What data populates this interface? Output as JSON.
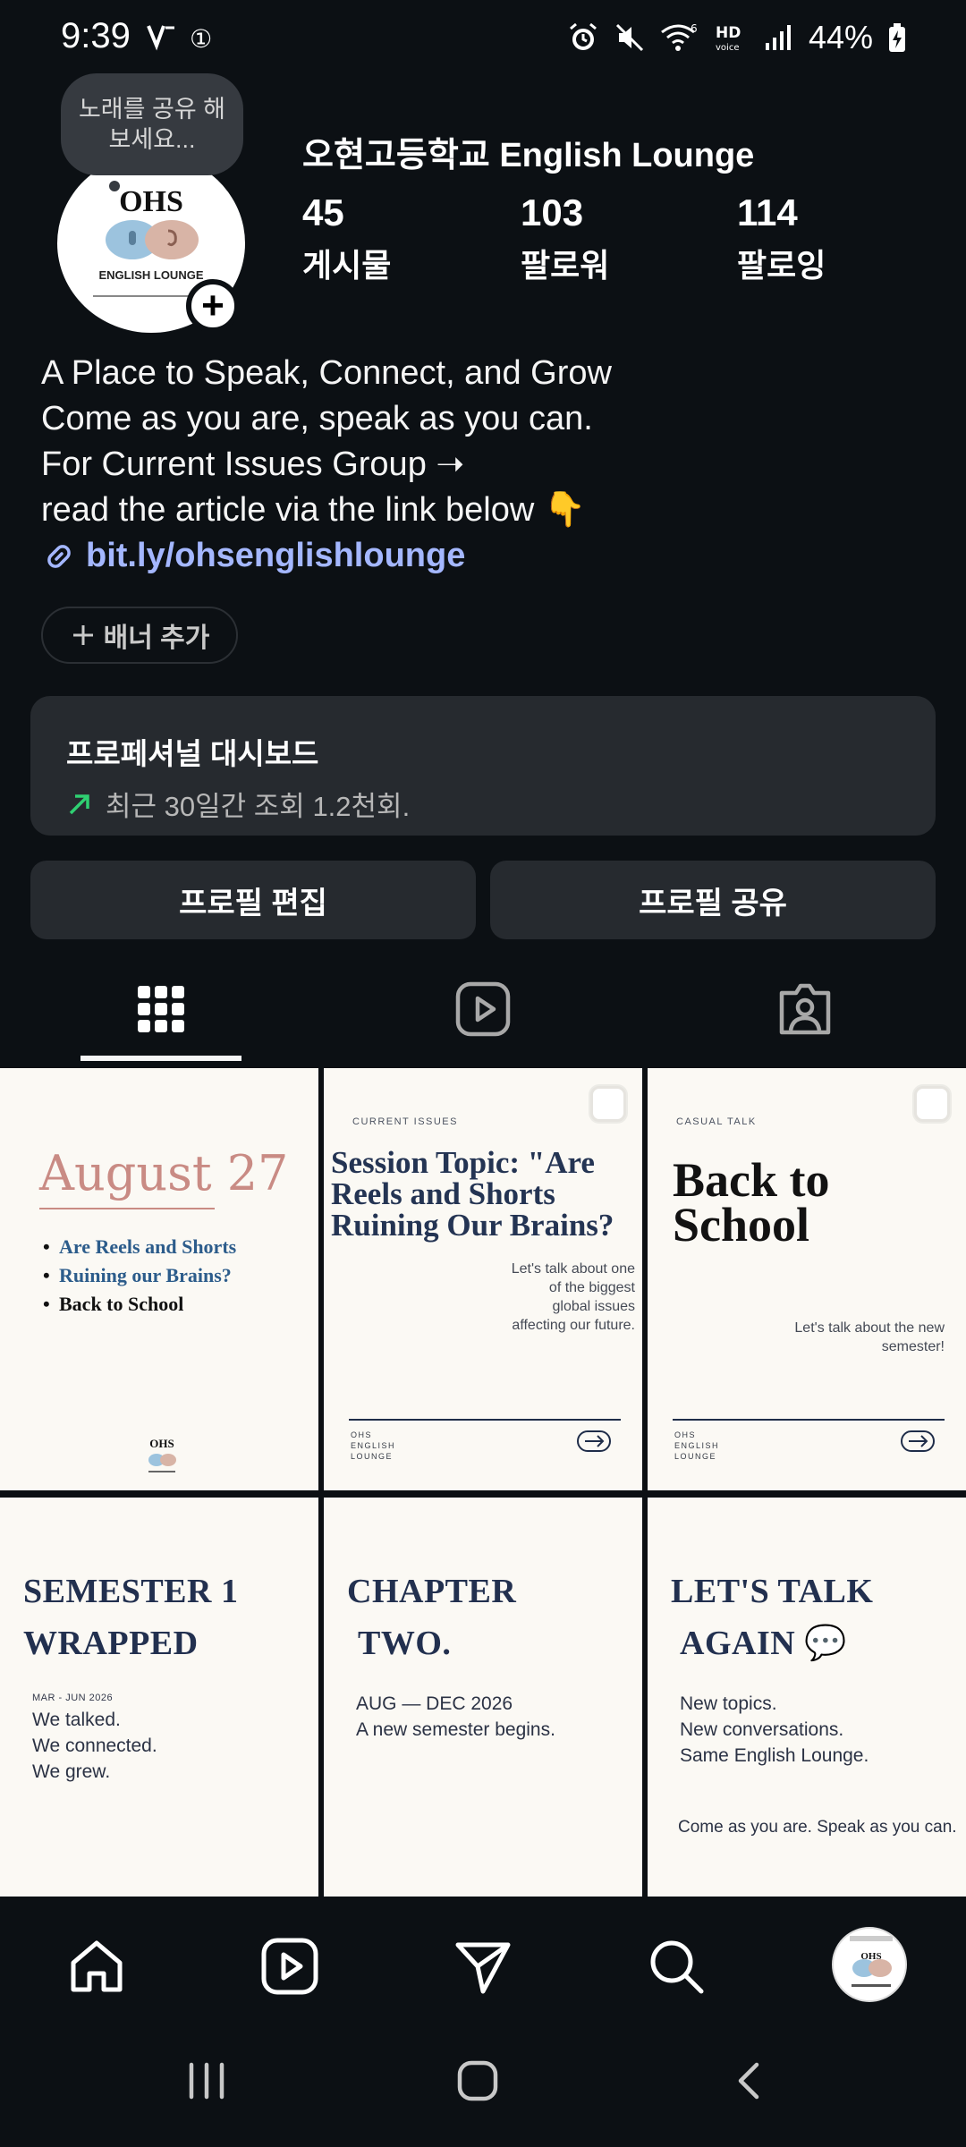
{
  "status": {
    "time": "9:39",
    "time_suffix": "①",
    "battery": "44%"
  },
  "profile": {
    "note": "노래를 공유 해보세요...",
    "name": "오현고등학교 English Lounge",
    "avatar_logo_text": "OHS",
    "avatar_caption": "ENGLISH LOUNGE",
    "stats": [
      {
        "value": "45",
        "label": "게시물"
      },
      {
        "value": "103",
        "label": "팔로워"
      },
      {
        "value": "114",
        "label": "팔로잉"
      }
    ],
    "bio": [
      "A Place to Speak, Connect, and Grow",
      "Come as you are, speak as you can.",
      "For Current Issues Group ➝",
      "read the article via the link below 👇"
    ],
    "link": "bit.ly/ohsenglishlounge",
    "banner_button": "배너 추가"
  },
  "dashboard": {
    "title": "프로페셔널 대시보드",
    "subtitle": "최근 30일간 조회 1.2천회."
  },
  "actions": {
    "edit": "프로필 편집",
    "share": "프로필 공유"
  },
  "posts": {
    "p1": {
      "title": "August 27",
      "items": [
        "Are Reels and Shorts",
        "Ruining our Brains?",
        "Back to School"
      ],
      "logo": "OHS"
    },
    "p2": {
      "eyebrow": "CURRENT ISSUES",
      "title": "Session Topic: \"Are Reels and Shorts Ruining Our Brains?",
      "desc": "Let's talk about one of the biggest global issues affecting our future.",
      "foot": "OHS ENGLISH LOUNGE"
    },
    "p3": {
      "eyebrow": "CASUAL TALK",
      "title": "Back to School",
      "desc": "Let's talk about the new semester!",
      "foot": "OHS ENGLISH LOUNGE"
    },
    "p4": {
      "title_line1": "SEMESTER 1",
      "title_line2": "WRAPPED",
      "date": "MAR - JUN 2026",
      "lines": [
        "We talked.",
        "We connected.",
        "We grew."
      ]
    },
    "p5": {
      "title_line1": "CHAPTER",
      "title_line2": "TWO.",
      "lines": [
        "AUG — DEC 2026",
        "A new semester begins."
      ]
    },
    "p6": {
      "title_line1": "LET'S TALK",
      "title_line2": "AGAIN 💬",
      "lines": [
        "New topics.",
        "New conversations.",
        "Same English Lounge."
      ],
      "foot": "Come as you are.  Speak as you can."
    }
  },
  "colors": {
    "background": "#0c1014",
    "card": "#262a2f",
    "link": "#a4b7ff",
    "trend_green": "#2fd072",
    "post_bg": "#fbf9f4"
  }
}
